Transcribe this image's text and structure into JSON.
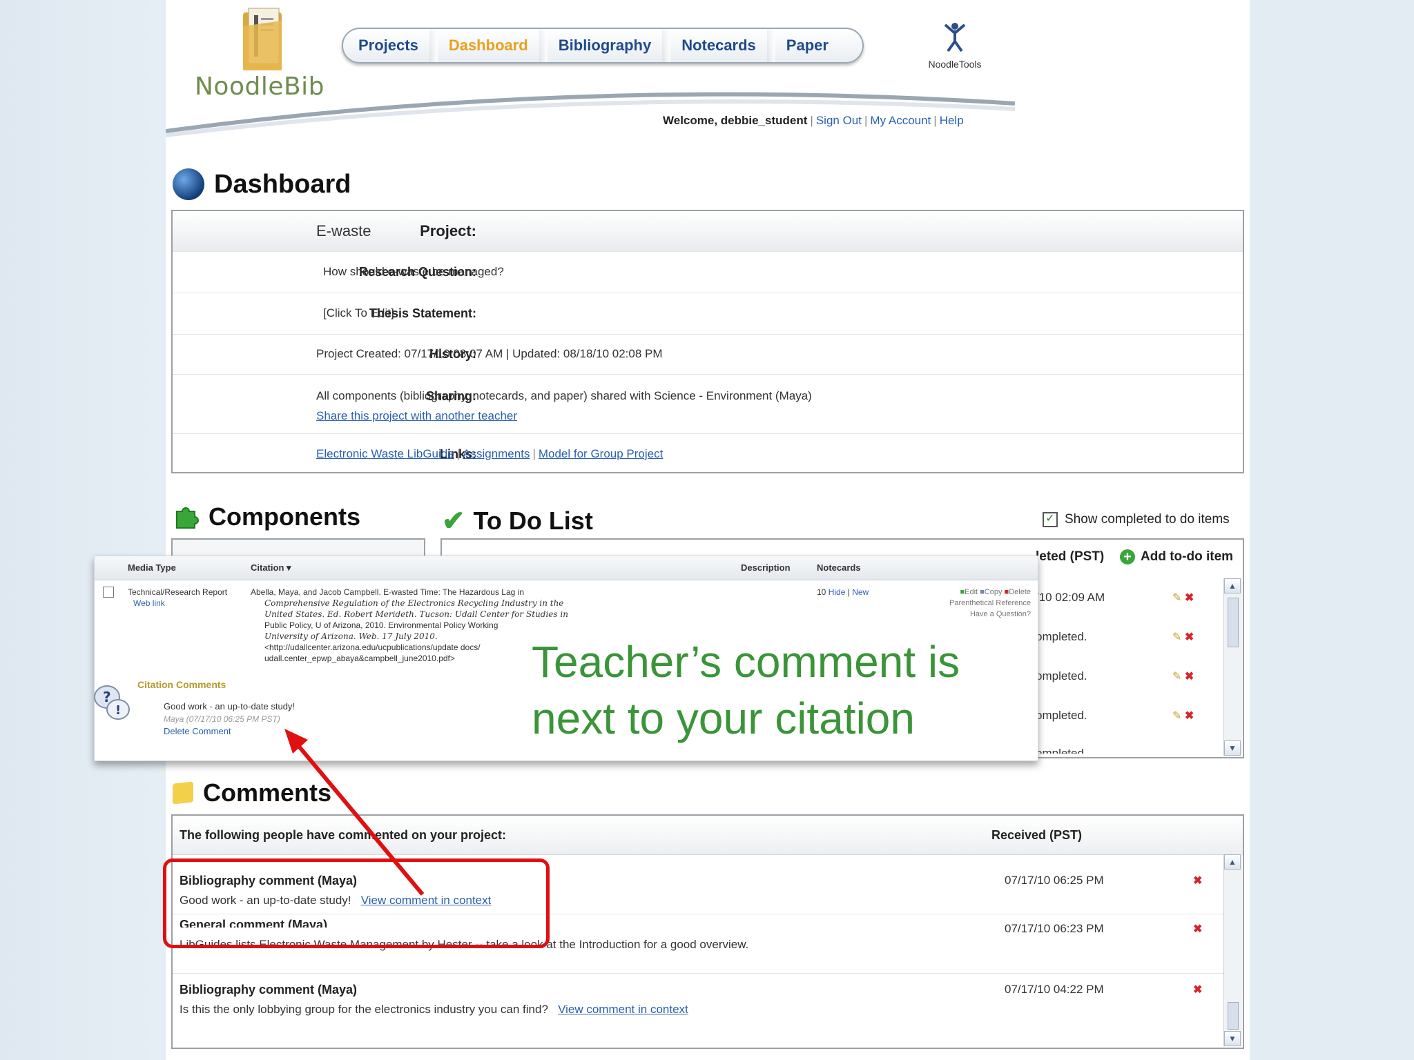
{
  "header": {
    "logo_text": "NoodleBib",
    "nav": [
      "Projects",
      "Dashboard",
      "Bibliography",
      "Notecards",
      "Paper"
    ],
    "active_nav": "Dashboard",
    "noodletools_label": "NoodleTools",
    "welcome_prefix": "Welcome, debbie_student",
    "links": [
      "Sign Out",
      "My Account",
      "Help"
    ]
  },
  "dashboard": {
    "title": "Dashboard",
    "rows": [
      {
        "label": "Project:",
        "value": "E-waste"
      },
      {
        "label": "Research Question:",
        "value": "How should e-waste be managed?"
      },
      {
        "label": "Thesis Statement:",
        "value": "[Click To Edit]"
      },
      {
        "label": "History:",
        "value": "Project Created: 07/17/10 08:07 AM | Updated: 08/18/10 02:08 PM"
      },
      {
        "label": "Sharing:",
        "value": "All components (bibliography, notecards, and paper) shared with Science - Environment (Maya)",
        "link": "Share this project with another teacher"
      },
      {
        "label": "Links:",
        "links": [
          "Electronic Waste LibGuide",
          "Assignments",
          "Model for Group Project"
        ]
      }
    ]
  },
  "components": {
    "title": "Components"
  },
  "todo": {
    "title": "To Do List",
    "show_completed": "Show completed to do items",
    "col_completed": "leted (PST)",
    "add_label": "Add to-do item",
    "rows": [
      "/10 02:09 AM",
      "ompleted.",
      "ompleted.",
      "ompleted.",
      "ompleted"
    ]
  },
  "overlay": {
    "headers": [
      "Media Type",
      "Citation ▾",
      "Description",
      "Notecards"
    ],
    "media_type": "Technical/Research Report",
    "web_link": "Web link",
    "citation_lines": [
      "Abella, Maya, and Jacob Campbell. E-wasted Time: The Hazardous Lag in",
      "Comprehensive Regulation of the Electronics Recycling Industry in the",
      "United States. Ed. Robert Merideth. Tucson: Udall Center for Studies in",
      "Public Policy, U of Arizona, 2010. Environmental Policy Working",
      "University of Arizona. Web. 17 July 2010.",
      "<http://udallcenter.arizona.edu/ucpublications/update docs/",
      "udall.center_epwp_abaya&campbell_june2010.pdf>"
    ],
    "notecards": "10",
    "notecard_links": [
      "Hide",
      "New"
    ],
    "actions": [
      "Edit",
      "Copy",
      "Delete"
    ],
    "action_line2": "Parenthetical Reference",
    "action_line3": "Have a Question?",
    "citation_comments_title": "Citation Comments",
    "comment_text": "Good work - an up-to-date study!",
    "comment_meta": "Maya (07/17/10 06:25 PM PST)",
    "delete_comment": "Delete Comment"
  },
  "callout": {
    "line1": "Teacher’s comment is",
    "line2": "next to your citation"
  },
  "comments": {
    "title": "Comments",
    "header_left": "The following people have commented on your project:",
    "header_right": "Received (PST)",
    "items": [
      {
        "title": "Bibliography comment (Maya)",
        "text": "Good work - an up-to-date study!",
        "link": "View comment in context",
        "date": "07/17/10 06:25 PM"
      },
      {
        "title": "General comment (Maya)",
        "text": "LibGuides lists Electronic Waste Management by Hester -- take a look at the Introduction for a good overview.",
        "date": "07/17/10 06:23 PM"
      },
      {
        "title": "Bibliography comment (Maya)",
        "text": "Is this the only lobbying group for the electronics industry you can find?",
        "link": "View comment in context",
        "date": "07/17/10 04:22 PM"
      }
    ]
  },
  "colors": {
    "accent": "#e7a11c",
    "nav_text": "#1f4b8a",
    "link": "#2a5fb0",
    "callout": "#3a9438",
    "highlight": "#e01010"
  }
}
